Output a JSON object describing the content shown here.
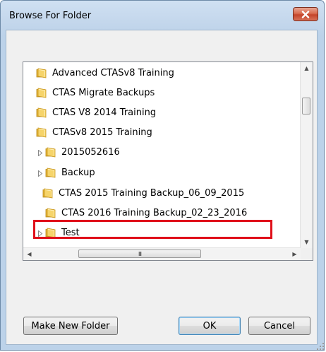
{
  "dialog": {
    "title": "Browse For Folder",
    "close_icon": "close-icon",
    "close_color": "#c4442a"
  },
  "tree": {
    "items": [
      {
        "label": "Advanced CTASv8 Training",
        "expandable": false
      },
      {
        "label": "CTAS Migrate Backups",
        "expandable": false
      },
      {
        "label": "CTAS V8 2014 Training",
        "expandable": false
      },
      {
        "label": "CTASv8 2015 Training",
        "expandable": false
      },
      {
        "label": "2015052616",
        "expandable": true
      },
      {
        "label": "Backup",
        "expandable": true
      },
      {
        "label": "CTAS 2015 Training Backup_06_09_2015",
        "expandable": false,
        "selected": true
      },
      {
        "label": "CTAS 2016 Training Backup_02_23_2016",
        "expandable": false
      },
      {
        "label": "Test",
        "expandable": true
      }
    ],
    "highlight_color": "#e0101a",
    "folder_icon": "folder-icon"
  },
  "scrollbars": {
    "hthumb_grip": "III"
  },
  "buttons": {
    "make_new_folder": "Make New Folder",
    "ok": "OK",
    "cancel": "Cancel"
  }
}
